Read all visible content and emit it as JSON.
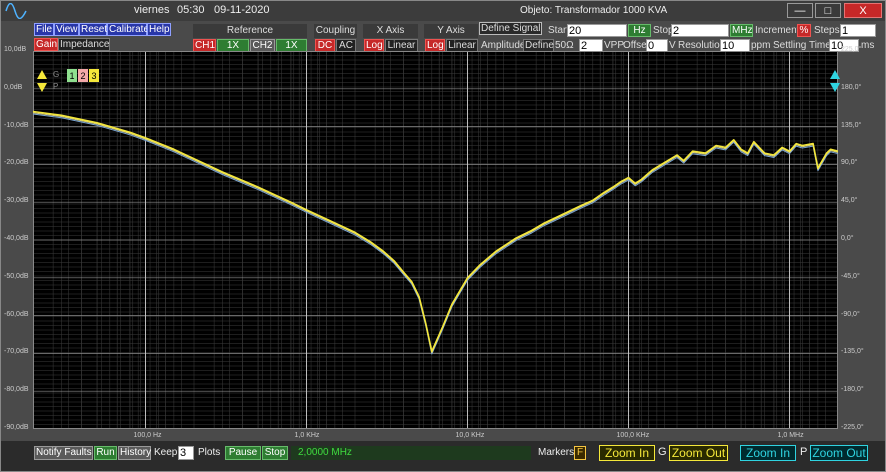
{
  "window": {
    "day": "viernes",
    "time": "05:30",
    "date": "09-11-2020",
    "object_title": "Objeto: Transformador 1000 KVA",
    "minimize": "—",
    "maximize": "□",
    "close": "X"
  },
  "menu": {
    "file": "File",
    "view": "View",
    "reset": "Reset",
    "calibrate": "Calibrate",
    "help": "Help",
    "gain": "Gain",
    "impedance": "Impedance"
  },
  "reference": {
    "header": "Reference",
    "ch1": "CH1",
    "ch1_scale": "1X",
    "ch2": "CH2",
    "ch2_scale": "1X"
  },
  "coupling": {
    "header": "Coupling",
    "dc": "DC",
    "ac": "AC"
  },
  "xaxis": {
    "header": "X Axis",
    "log": "Log",
    "linear": "Linear"
  },
  "yaxis": {
    "header": "Y Axis",
    "log": "Log",
    "linear": "Linear"
  },
  "signal": {
    "define_signal": "Define Signal",
    "start_label": "Start",
    "start_value": "20",
    "start_unit": "Hz",
    "stop_label": "Stop",
    "stop_value": "2",
    "stop_unit": "MHz",
    "increment_label": "Increment",
    "increment_unit": "%",
    "steps_label": "Steps",
    "steps_value": "1",
    "amplitude_label": "Amplitude",
    "define_btn": "Define",
    "impedance_value": "50Ω",
    "amplitude_value": "2",
    "amplitude_unit": "VPP",
    "offset_label": "Offset",
    "offset_value": "0",
    "offset_unit": "V",
    "resolution_label": "Resolution",
    "resolution_value": "10",
    "resolution_unit": "ppm",
    "settling_label": "Settling Time",
    "settling_value": "10",
    "settling_unit": "ms"
  },
  "plot_controls": {
    "g_label": "G",
    "p_label": "P",
    "trace1": "1",
    "trace2": "2",
    "trace3": "3"
  },
  "colors": {
    "trace_main": "#f5e83a",
    "trace_secondary": "#d6d08a",
    "trace_tertiary": "#7aa6d6",
    "grid_major": "#8a8a8a",
    "grid_minor": "#3c3c3c"
  },
  "chart_data": {
    "type": "line",
    "title": "",
    "xlabel": "",
    "ylabel": "",
    "x_scale": "log",
    "xlim": [
      20,
      2000000
    ],
    "ylim": [
      -90,
      10
    ],
    "y2lim": [
      -225,
      225
    ],
    "x_ticks": [
      {
        "value": 100,
        "label": "100,0 Hz"
      },
      {
        "value": 1000,
        "label": "1,0 KHz"
      },
      {
        "value": 10000,
        "label": "10,0 KHz"
      },
      {
        "value": 100000,
        "label": "100,0 KHz"
      },
      {
        "value": 1000000,
        "label": "1,0 MHz"
      }
    ],
    "y_ticks": [
      "10,0dB",
      "0,0dB",
      "-10,0dB",
      "-20,0dB",
      "-30,0dB",
      "-40,0dB",
      "-50,0dB",
      "-60,0dB",
      "-70,0dB",
      "-80,0dB",
      "-90,0dB"
    ],
    "y_tick_values": [
      10,
      0,
      -10,
      -20,
      -30,
      -40,
      -50,
      -60,
      -70,
      -80,
      -90
    ],
    "y2_ticks": [
      "225,0°",
      "180,0°",
      "135,0°",
      "90,0°",
      "45,0°",
      "0,0°",
      "-45,0°",
      "-90,0°",
      "-135,0°",
      "-180,0°",
      "-225,0°"
    ],
    "grid": true,
    "series": [
      {
        "x": [
          20,
          30,
          50,
          80,
          100,
          150,
          200,
          300,
          500,
          800,
          1000,
          1500,
          2000,
          2500,
          3000,
          3500,
          4000,
          4500,
          5000,
          5500,
          6000,
          7000,
          8000,
          10000,
          12000,
          15000,
          20000,
          25000,
          30000,
          40000,
          50000,
          60000,
          70000,
          80000,
          90000,
          100000,
          110000,
          120000,
          140000,
          160000,
          200000,
          220000,
          250000,
          300000,
          350000,
          400000,
          450000,
          500000,
          550000,
          600000,
          700000,
          800000,
          900000,
          1000000,
          1100000,
          1200000,
          1400000,
          1500000,
          1700000,
          1800000,
          2000000
        ],
        "y": [
          -6,
          -7,
          -9,
          -11.5,
          -13,
          -16,
          -18.5,
          -22,
          -26,
          -30,
          -32,
          -35.5,
          -38,
          -40.5,
          -43,
          -45.5,
          -48.5,
          -51,
          -55,
          -62,
          -69.5,
          -63,
          -57,
          -50,
          -46.5,
          -43,
          -39.5,
          -37.5,
          -35.5,
          -33,
          -31,
          -29.5,
          -27.5,
          -26,
          -24.5,
          -23.5,
          -25,
          -24,
          -21.5,
          -20,
          -17.5,
          -19,
          -16.5,
          -17,
          -15,
          -15.5,
          -13.5,
          -16,
          -17,
          -14,
          -17,
          -17.5,
          -15.5,
          -16.5,
          -14.5,
          -15,
          -14.5,
          -21,
          -17,
          -16,
          -16.5
        ]
      }
    ]
  },
  "bottom": {
    "notify_faults": "Notify Faults",
    "run": "Run",
    "history": "History",
    "keep_label": "Keep",
    "keep_value": "3",
    "plots_label": "Plots",
    "pause": "Pause",
    "stop": "Stop",
    "frequency": "2,0000 MHz",
    "markers_label": "Markers",
    "markers_key": "F",
    "zoom_in": "Zoom In",
    "g_key": "G",
    "zoom_out": "Zoom Out",
    "zoom_in2": "Zoom In",
    "p_key": "P",
    "zoom_out2": "Zoom Out"
  }
}
